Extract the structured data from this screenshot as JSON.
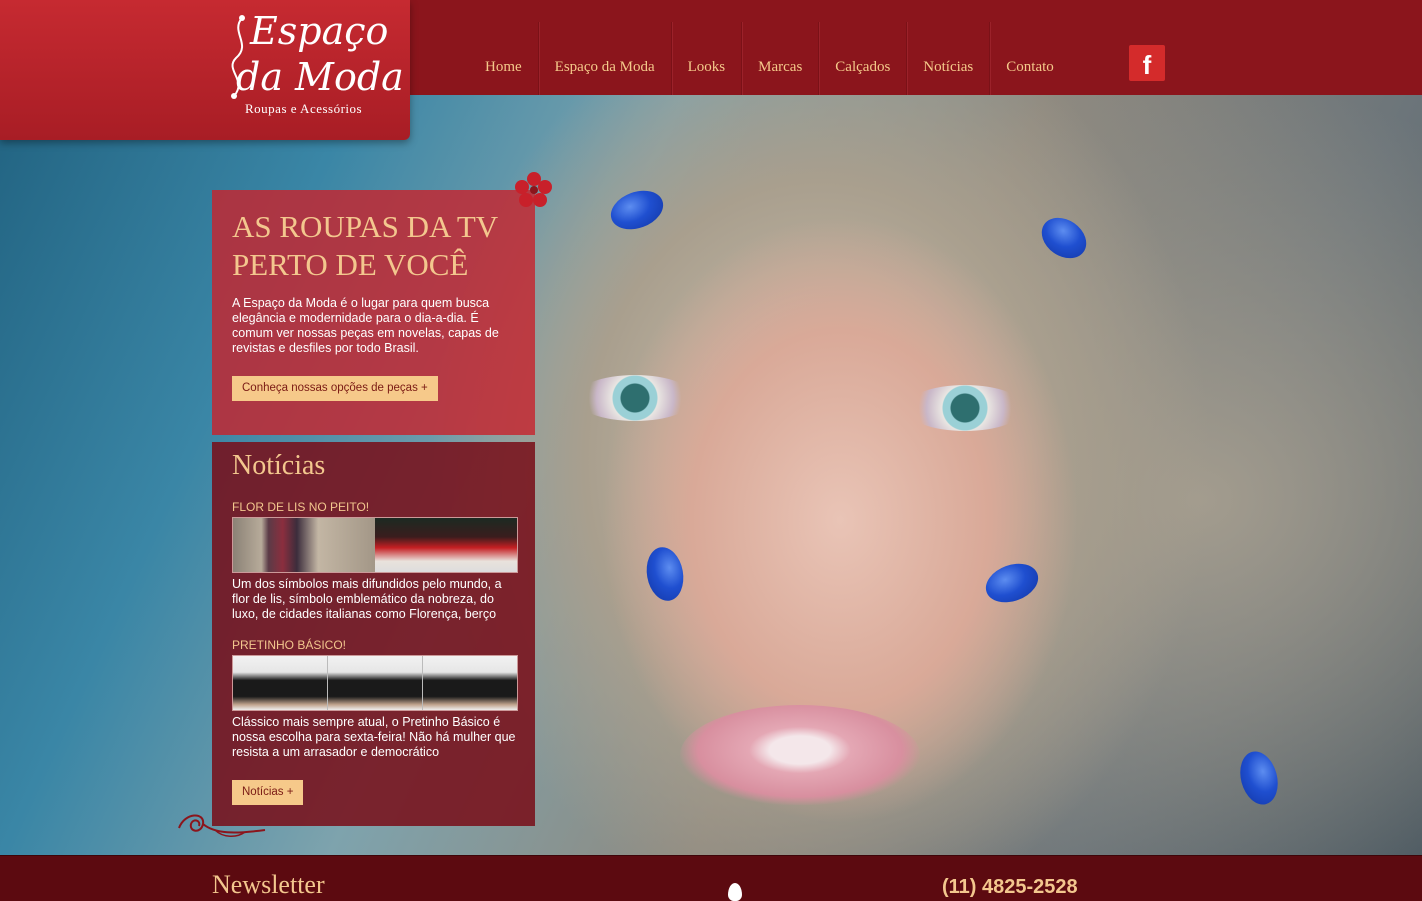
{
  "brand": {
    "logo_line1": "Espaço",
    "logo_line2": "da Moda",
    "tagline": "Roupas e Acessórios"
  },
  "nav": {
    "items": [
      {
        "label": "Home"
      },
      {
        "label": "Espaço da Moda"
      },
      {
        "label": "Looks"
      },
      {
        "label": "Marcas"
      },
      {
        "label": "Calçados"
      },
      {
        "label": "Notícias"
      },
      {
        "label": "Contato"
      }
    ],
    "social_label": "f"
  },
  "promo": {
    "headline_line1": "AS ROUPAS DA TV",
    "headline_line2": "PERTO DE VOCÊ",
    "text": "A Espaço da Moda é o lugar para quem busca elegância e modernidade para o dia-a-dia. É comum ver nossas peças em novelas, capas de revistas e desfiles por todo Brasil.",
    "button": "Conheça nossas opções de peças +"
  },
  "news": {
    "title": "Notícias",
    "items": [
      {
        "title": "FLOR DE LIS NO PEITO!",
        "text": "Um dos símbolos mais difundidos pelo mundo, a flor de lis, símbolo emblemático da nobreza, do luxo, de cidades italianas como Florença, berço"
      },
      {
        "title": "PRETINHO BÁSICO!",
        "text": "Clássico mais sempre atual, o Pretinho Básico é nossa escolha para sexta-feira! Não há mulher que resista a um arrasador e democrático"
      }
    ],
    "button": "Notícias +"
  },
  "footer": {
    "newsletter": "Newsletter",
    "phone": "(11) 4825-2528"
  },
  "colors": {
    "topbar": "#8b151c",
    "accent": "#f3c78e",
    "panel_red": "#c6242e",
    "panel_dark": "#780e18",
    "footer": "#5c0a10"
  }
}
